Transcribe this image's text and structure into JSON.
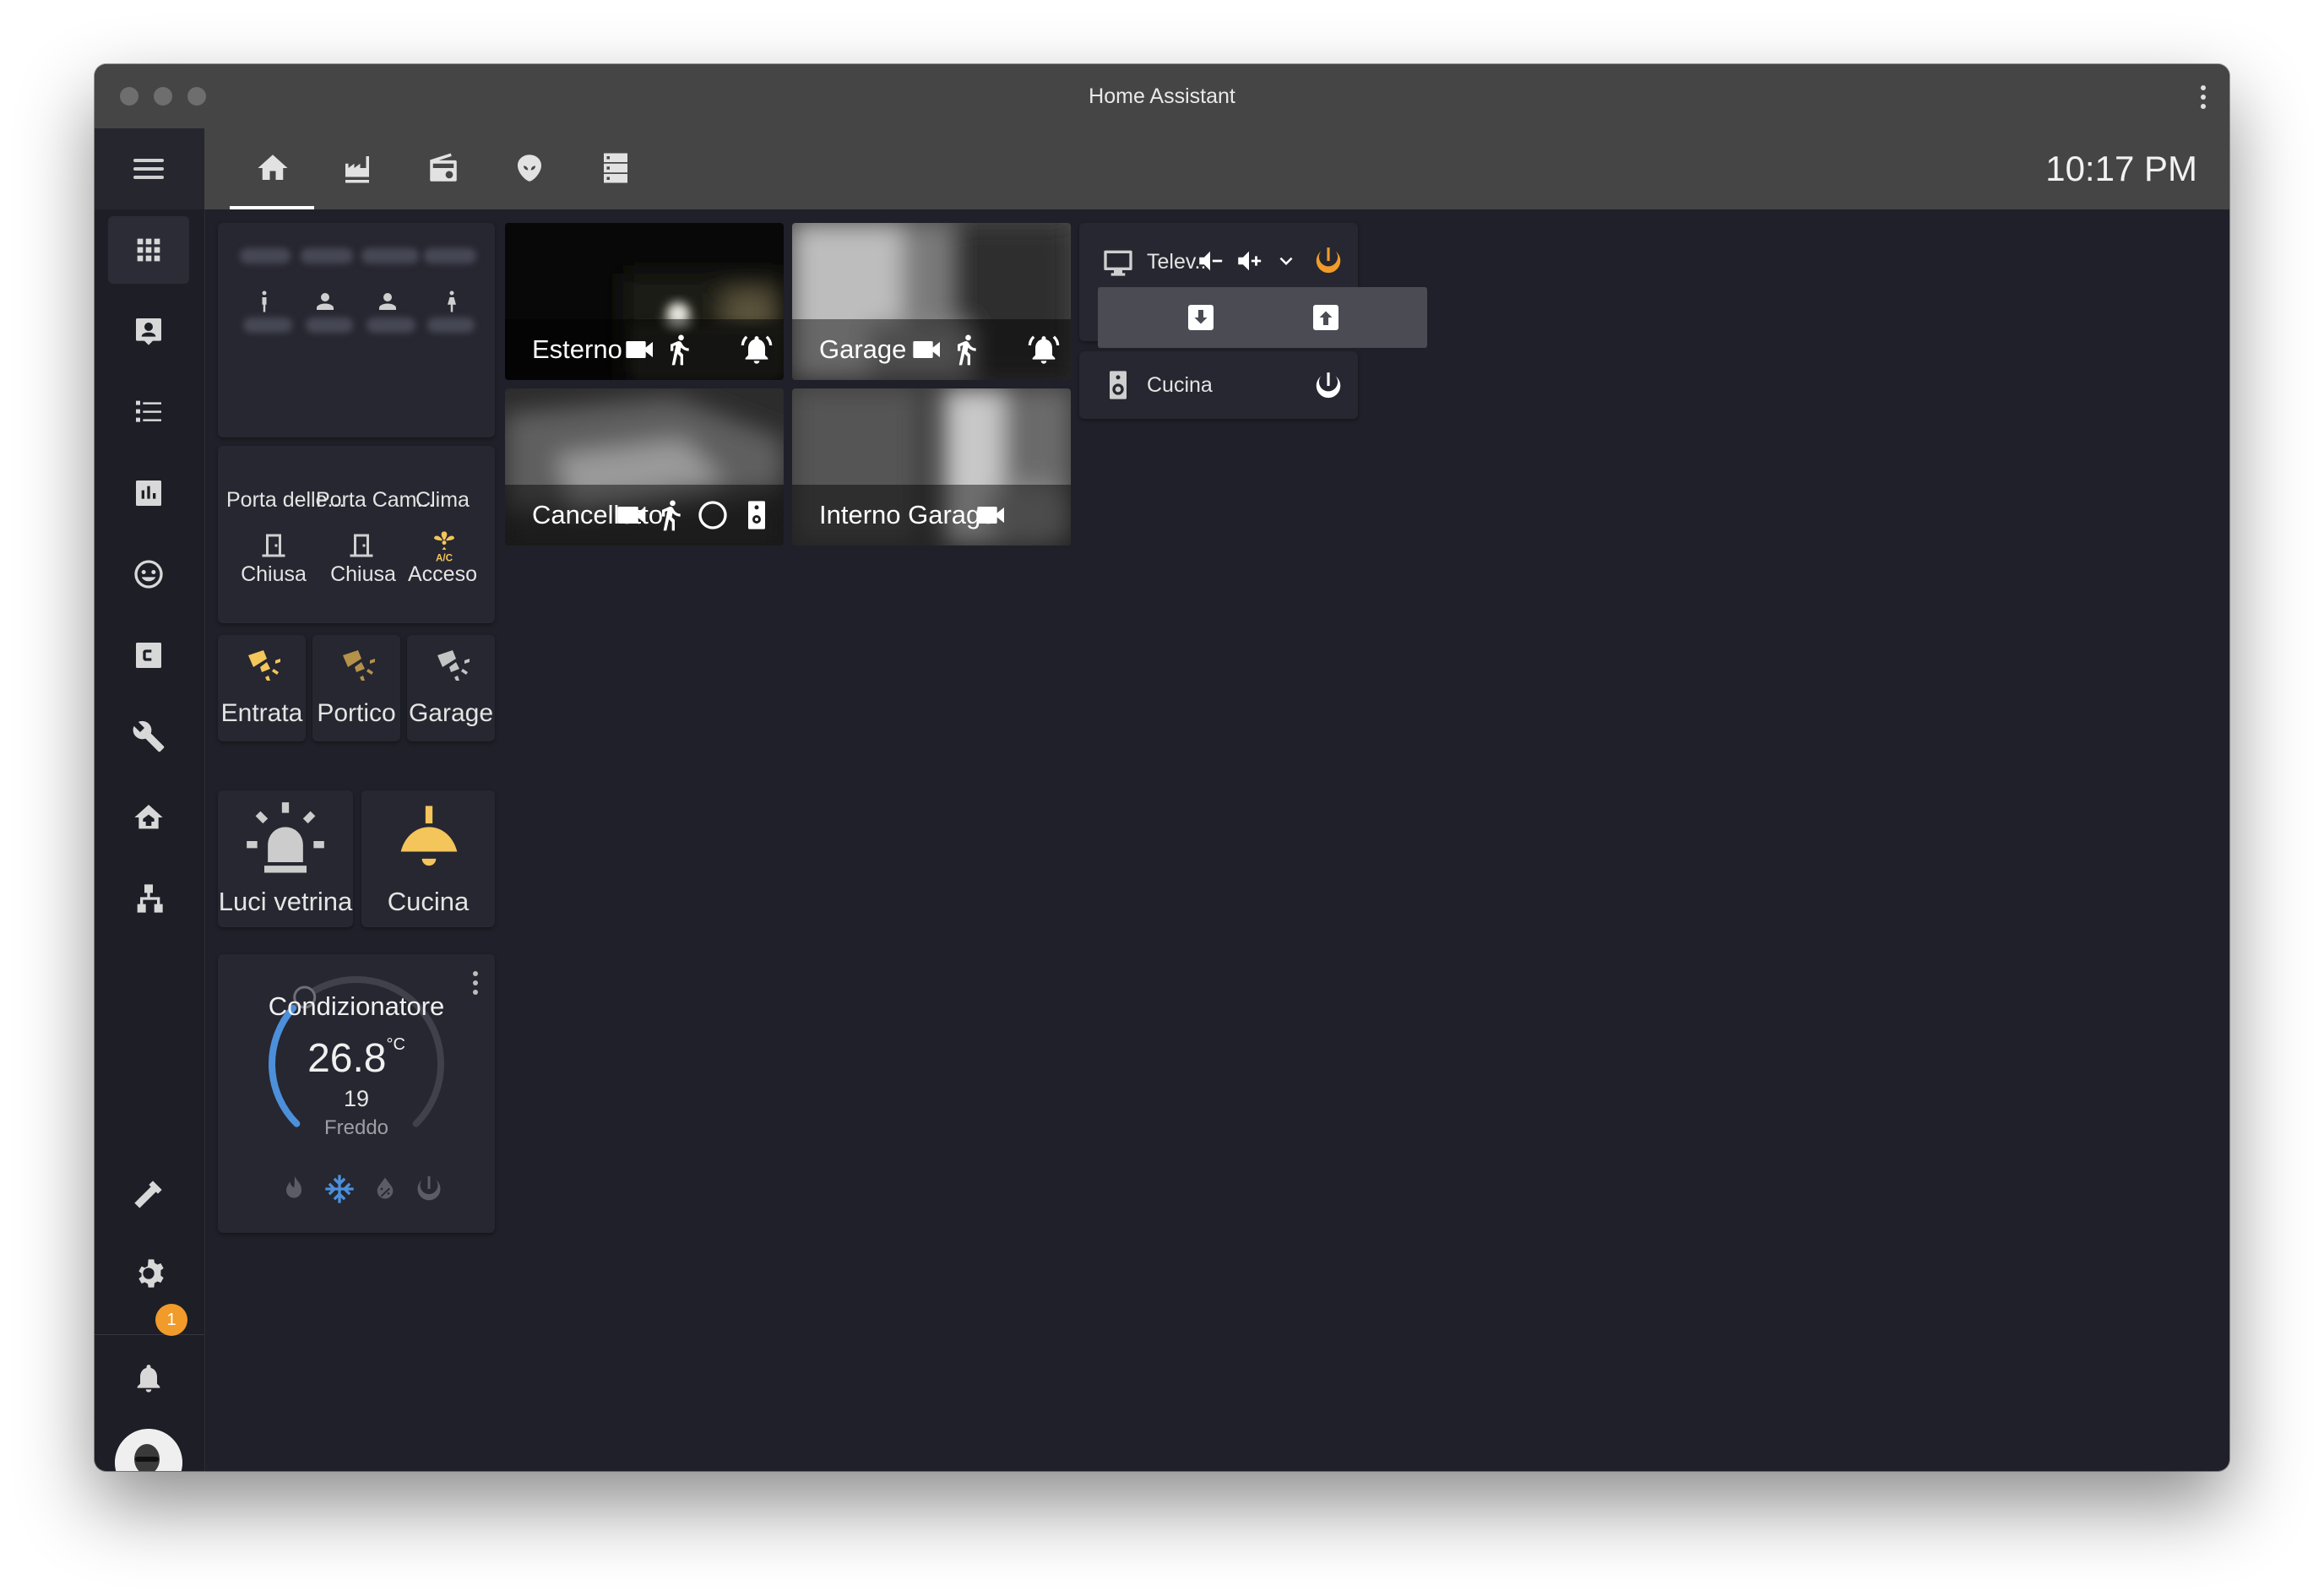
{
  "window": {
    "title": "Home Assistant"
  },
  "header": {
    "time": "10:17 PM",
    "tabs": [
      "home-icon",
      "factory-icon",
      "radio-icon",
      "alien-icon",
      "server-icon"
    ]
  },
  "sidebar": {
    "items": [
      "apps-icon",
      "account-box-icon",
      "list-icon",
      "chart-icon",
      "emoticon-icon",
      "c-box-icon",
      "wrench-icon",
      "home-tree-icon",
      "sitemap-icon",
      "hammer-icon",
      "gear-icon"
    ],
    "notifications": "1"
  },
  "entities": {
    "doors": [
      {
        "name": "Porta delle...",
        "state": "Chiusa"
      },
      {
        "name": "Porta Cam...",
        "state": "Chiusa"
      },
      {
        "name": "Clima",
        "state": "Acceso"
      }
    ],
    "lights_small": [
      "Entrata",
      "Portico",
      "Garage"
    ],
    "lights_big": [
      "Luci vetrina",
      "Cucina"
    ]
  },
  "thermostat": {
    "name": "Condizionatore",
    "current": "26.8",
    "unit": "°C",
    "target": "19",
    "mode": "Freddo",
    "level": 0.36
  },
  "cameras": [
    "Esterno",
    "Garage",
    "Cancelletto",
    "Interno Garage"
  ],
  "media": {
    "tv": "Telev...",
    "speaker": "Cucina"
  },
  "colors": {
    "accent_orange": "#f09b2a",
    "cool_blue": "#4c90dc",
    "light_yellow": "#f3c55b",
    "bg": "#1f2029",
    "card": "#262730"
  }
}
